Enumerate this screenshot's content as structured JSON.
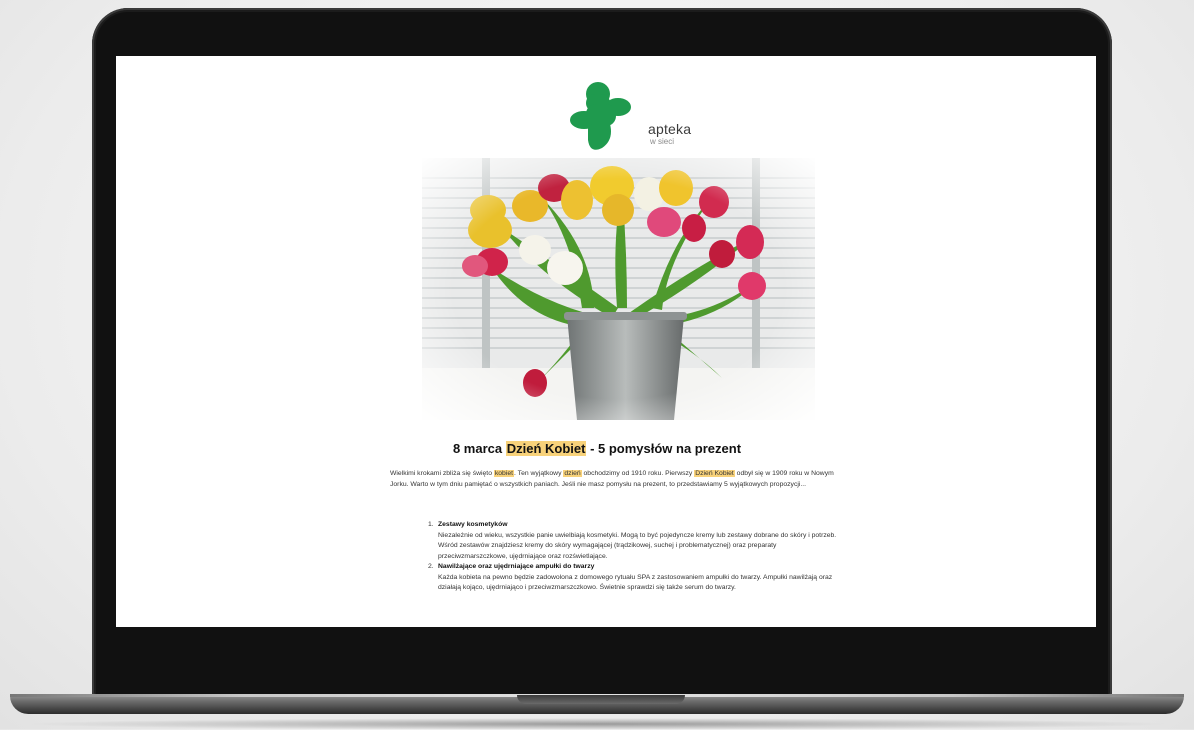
{
  "logo": {
    "name": "apteka",
    "sub": "w sieci",
    "colors": {
      "brand_green": "#1f9a4e"
    }
  },
  "hero": {
    "icon": "tulips-in-bucket-photo"
  },
  "headline": {
    "pre": "8 marca ",
    "highlight": "Dzień Kobiet",
    "post": " - 5 pomysłów na prezent"
  },
  "intro": {
    "p1": "Wielkimi krokami zbliża się święto ",
    "kobiet": "kobiet",
    "p2": ". Ten wyjątkowy ",
    "dzien": "dzień",
    "p3": " obchodzimy od 1910 roku. Pierwszy ",
    "dzien_kobiet": "Dzień Kobiet",
    "p4": " odbył się w 1909 roku w Nowym Jorku. Warto w tym dniu pamiętać o wszystkich paniach. Jeśli nie masz pomysłu na prezent, to przedstawiamy 5 wyjątkowych propozycji..."
  },
  "list": [
    {
      "num": "1.",
      "title": "Zestawy kosmetyków",
      "text": "Niezależnie od wieku, wszystkie panie uwielbiają kosmetyki. Mogą to być pojedyncze kremy lub zestawy dobrane do skóry i potrzeb. Wśród zestawów znajdziesz kremy do skóry wymagającej (trądzikowej, suchej i problematycznej) oraz preparaty przeciwzmarszczkowe, ujędrniające oraz rozświetlające."
    },
    {
      "num": "2.",
      "title": "Nawilżające oraz ujędrniające ampułki do twarzy",
      "text": "Każda kobieta na pewno będzie zadowolona z domowego rytuału SPA z zastosowaniem ampułki do twarzy. Ampułki nawilżają oraz działają kojąco, ujędrniająco i przeciwzmarszczkowo. Świetnie sprawdzi się także serum do twarzy."
    }
  ],
  "colors": {
    "highlight": "#f8d27a",
    "bezel": "#1c1c1c"
  }
}
